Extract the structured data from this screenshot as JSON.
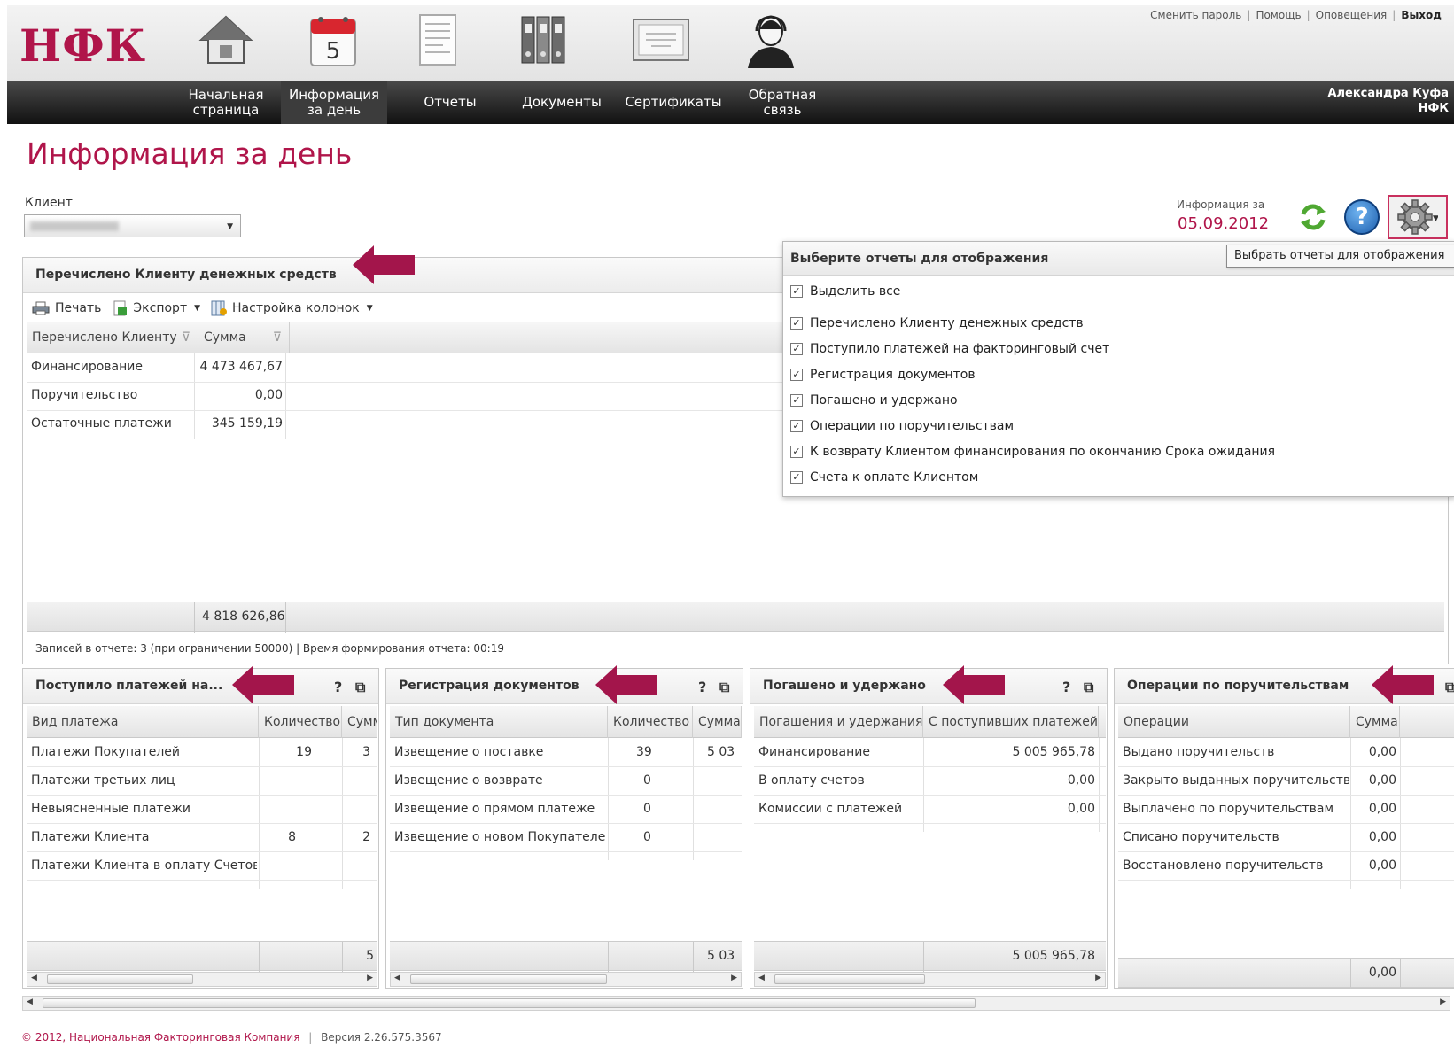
{
  "brand": {
    "logo": "НФК",
    "color": "#b0154a"
  },
  "top_links": {
    "change_password": "Сменить пароль",
    "help": "Помощь",
    "notifications": "Оповещения",
    "logout": "Выход"
  },
  "nav": {
    "home": {
      "line1": "Начальная",
      "line2": "страница",
      "icon": "house-icon"
    },
    "daily": {
      "line1": "Информация",
      "line2": "за день",
      "icon": "calendar-icon",
      "calendar_day": "5"
    },
    "reports": {
      "label": "Отчеты",
      "icon": "report-icon"
    },
    "documents": {
      "label": "Документы",
      "icon": "binders-icon"
    },
    "certificates": {
      "label": "Сертификаты",
      "icon": "certificate-icon"
    },
    "feedback": {
      "line1": "Обратная",
      "line2": "связь",
      "icon": "operator-icon"
    }
  },
  "user": {
    "name": "Александра Куфа",
    "org": "НФК"
  },
  "page": {
    "title": "Информация за день",
    "client_label": "Клиент",
    "info_label": "Информация за",
    "info_date": "05.09.2012"
  },
  "main_panel": {
    "title": "Перечислено Клиенту денежных средств",
    "toolbar": {
      "print": "Печать",
      "export": "Экспорт",
      "columns": "Настройка колонок"
    },
    "columns": [
      "Перечислено Клиенту",
      "Сумма"
    ],
    "rows": [
      {
        "name": "Финансирование",
        "sum": "4 473 467,67"
      },
      {
        "name": "Поручительство",
        "sum": "0,00"
      },
      {
        "name": "Остаточные платежи",
        "sum": "345 159,19"
      }
    ],
    "total": "4 818 626,86",
    "status": "Записей в отчете:  3  (при ограничении 50000) | Время формирования отчета:  00:19"
  },
  "dropdown": {
    "header": "Выберите отчеты для отображения",
    "select_all": "Выделить все",
    "items": [
      "Перечислено Клиенту денежных средств",
      "Поступило платежей на факторинговый счет",
      "Регистрация документов",
      "Погашено и удержано",
      "Операции по поручительствам",
      "К возврату Клиентом финансирования по окончанию Срока ожидания",
      "Счета к оплате Клиентом"
    ],
    "tooltip": "Выбрать отчеты для отображения"
  },
  "panels": {
    "payments": {
      "title": "Поступило платежей на...",
      "columns": [
        "Вид платежа",
        "Количество",
        "Сумма"
      ],
      "rows": [
        [
          "Платежи Покупателей",
          "19",
          "3"
        ],
        [
          "Платежи третьих лиц",
          "",
          ""
        ],
        [
          "Невыясненные платежи",
          "",
          ""
        ],
        [
          "Платежи Клиента",
          "8",
          "2"
        ],
        [
          "Платежи Клиента в оплату Счетов",
          "",
          ""
        ]
      ],
      "total": "5"
    },
    "docs": {
      "title": "Регистрация документов",
      "columns": [
        "Тип документа",
        "Количество",
        "Сумма"
      ],
      "rows": [
        [
          "Извещение о поставке",
          "39",
          "5 03"
        ],
        [
          "Извещение о возврате",
          "0",
          ""
        ],
        [
          "Извещение о прямом платеже",
          "0",
          ""
        ],
        [
          "Извещение о новом Покупателе",
          "0",
          ""
        ]
      ],
      "total": "5 03"
    },
    "repaid": {
      "title": "Погашено и удержано",
      "columns": [
        "Погашения и удержания",
        "С поступивших платежей"
      ],
      "rows": [
        [
          "Финансирование",
          "5 005 965,78"
        ],
        [
          "В оплату счетов",
          "0,00"
        ],
        [
          "Комиссии с платежей",
          "0,00"
        ]
      ],
      "total": "5 005 965,78"
    },
    "guarantees": {
      "title": "Операции по поручительствам",
      "columns": [
        "Операции",
        "Сумма"
      ],
      "rows": [
        [
          "Выдано поручительств",
          "0,00"
        ],
        [
          "Закрыто выданных поручительств",
          "0,00"
        ],
        [
          "Выплачено по поручительствам",
          "0,00"
        ],
        [
          "Списано поручительств",
          "0,00"
        ],
        [
          "Восстановлено поручительств",
          "0,00"
        ]
      ],
      "total": "0,00"
    }
  },
  "footer": {
    "copyright": "© 2012, Национальная Факторинговая Компания",
    "version": "Версия  2.26.575.3567"
  }
}
